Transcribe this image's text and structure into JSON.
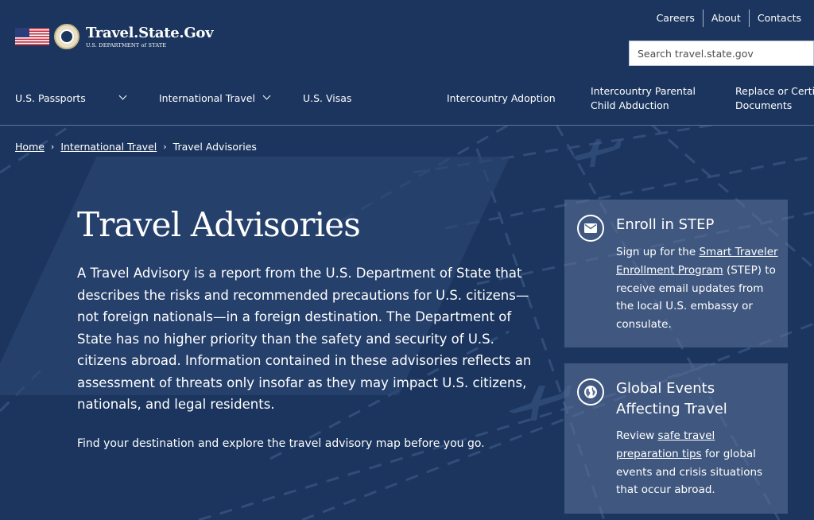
{
  "brand": {
    "title": "Travel.State.Gov",
    "subtitle": "U.S. DEPARTMENT of STATE"
  },
  "utility_nav": [
    "Careers",
    "About",
    "Contacts"
  ],
  "search": {
    "placeholder": "Search travel.state.gov"
  },
  "main_nav": [
    {
      "label": "U.S. Passports",
      "has_dropdown": true
    },
    {
      "label": "International Travel",
      "has_dropdown": true
    },
    {
      "label": "U.S. Visas",
      "has_dropdown": false
    },
    {
      "label": "Intercountry Adoption",
      "has_dropdown": false
    },
    {
      "label": "Intercountry Parental Child Abduction",
      "has_dropdown": false
    },
    {
      "label": "Replace or Certify Documents",
      "has_dropdown": false
    }
  ],
  "breadcrumb": {
    "home": "Home",
    "section": "International Travel",
    "current": "Travel Advisories",
    "separator": "›"
  },
  "page_title": "Travel Advisories",
  "intro": "A Travel Advisory is a report from the U.S. Department of State that describes the risks and recommended precautions for U.S. citizens—not foreign nationals—in a foreign destination. The Department of State has no higher priority than the safety and security of U.S. citizens abroad. Information contained in these advisories reflects an assessment of threats only insofar as they may impact U.S. citizens, nationals, and legal residents.",
  "cta": "Find your destination and explore the travel advisory map before you go.",
  "cards": {
    "step": {
      "icon": "envelope-icon",
      "title": "Enroll in STEP",
      "text_before": "Sign up for the ",
      "link": "Smart Traveler Enrollment Program",
      "text_after": " (STEP) to receive email updates from the local U.S. embassy or consulate."
    },
    "global": {
      "icon": "globe-icon",
      "title": "Global Events Affecting Travel",
      "text_before": "Review ",
      "link": "safe travel preparation tips",
      "text_after": " for global events and crisis situations that occur abroad."
    }
  },
  "colors": {
    "background": "#1b355e",
    "card": "#5c7298",
    "text": "#ffffff"
  }
}
